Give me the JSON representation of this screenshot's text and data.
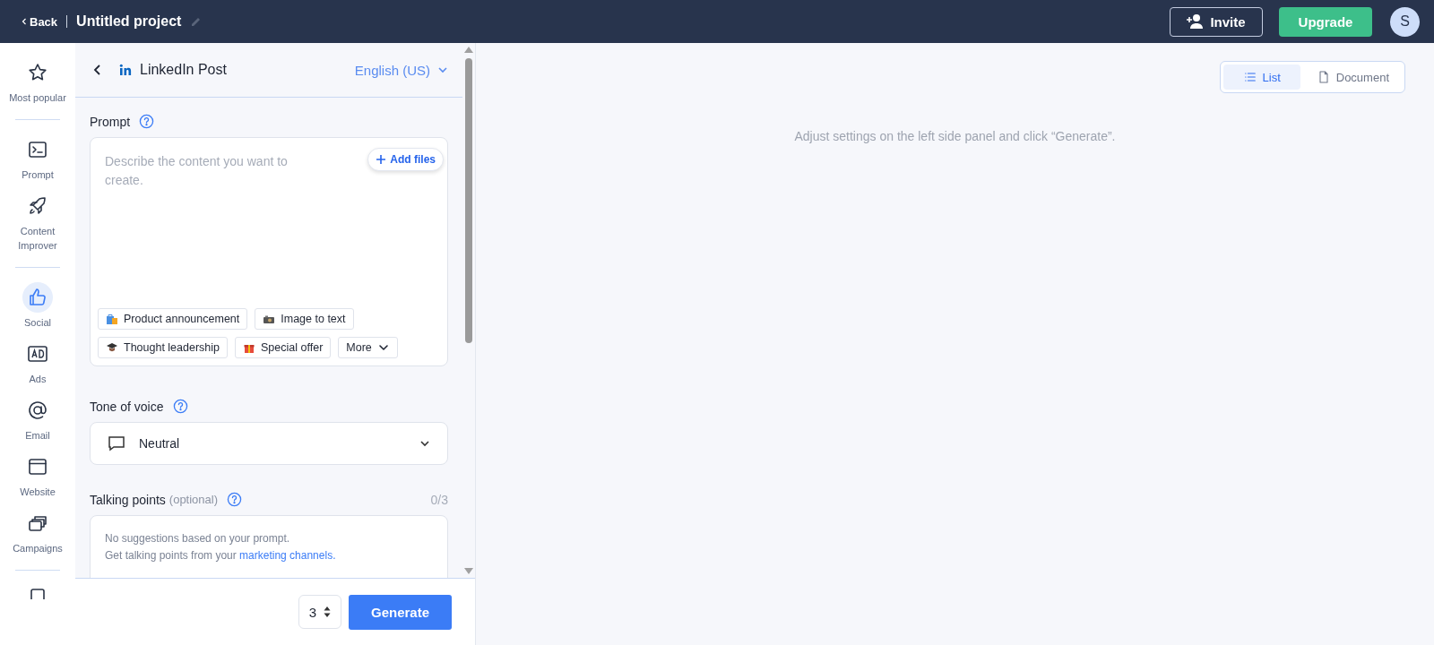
{
  "header": {
    "back": "Back",
    "project_title": "Untitled project",
    "invite": "Invite",
    "upgrade": "Upgrade",
    "avatar": "S"
  },
  "nav": [
    {
      "kind": "star",
      "label": "Most popular",
      "selected": false,
      "divider_after": true
    },
    {
      "kind": "prompt",
      "label": "Prompt",
      "selected": false,
      "divider_after": false
    },
    {
      "kind": "rocket",
      "label": "Content Improver",
      "selected": false,
      "divider_after": true
    },
    {
      "kind": "thumb",
      "label": "Social",
      "selected": true,
      "divider_after": false
    },
    {
      "kind": "ad",
      "label": "Ads",
      "selected": false,
      "divider_after": false
    },
    {
      "kind": "email",
      "label": "Email",
      "selected": false,
      "divider_after": false
    },
    {
      "kind": "website",
      "label": "Website",
      "selected": false,
      "divider_after": false
    },
    {
      "kind": "campaigns",
      "label": "Campaigns",
      "selected": false,
      "divider_after": true
    }
  ],
  "panel": {
    "title": "LinkedIn Post",
    "language": "English (US)",
    "prompt": {
      "label": "Prompt",
      "placeholder": "Describe the content you want to create.",
      "add_files": "Add files",
      "chips": [
        {
          "kind": "bag",
          "label": "Product announcement"
        },
        {
          "kind": "camera",
          "label": "Image to text"
        },
        {
          "kind": "cap",
          "label": "Thought leadership"
        },
        {
          "kind": "gift",
          "label": "Special offer"
        },
        {
          "kind": "more",
          "label": "More"
        }
      ]
    },
    "tone": {
      "label": "Tone of voice",
      "value": "Neutral"
    },
    "talking_points": {
      "label": "Talking points",
      "optional": "(optional)",
      "count": "0/3",
      "line_1": "No suggestions based on your prompt.",
      "line_2": "Get talking points from your ",
      "link": "marketing channels."
    },
    "quantity": "3",
    "generate": "Generate"
  },
  "output": {
    "views": [
      {
        "kind": "list",
        "label": "List",
        "selected": true
      },
      {
        "kind": "document",
        "label": "Document",
        "selected": false
      }
    ],
    "message": "Adjust settings on the left side panel and click “Generate”."
  }
}
